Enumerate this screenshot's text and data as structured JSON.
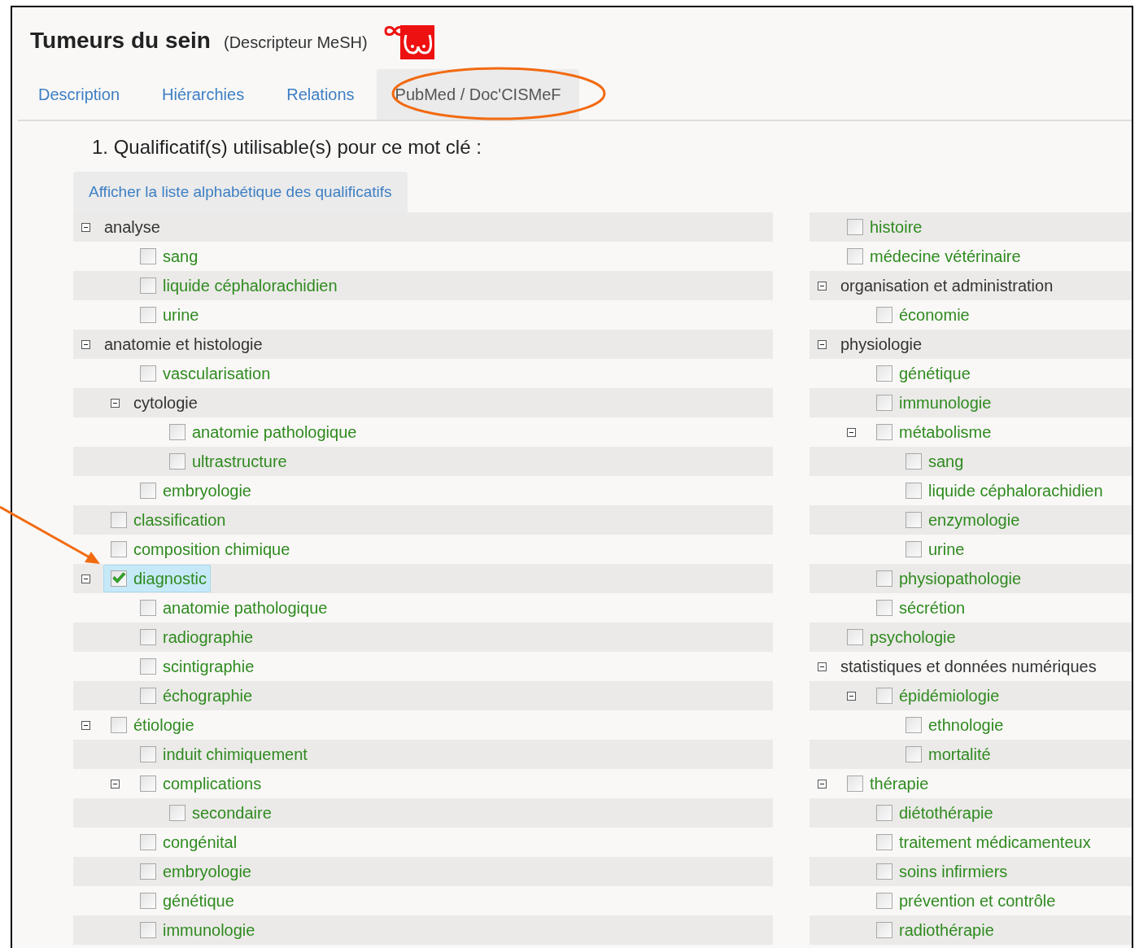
{
  "header": {
    "title": "Tumeurs du sein",
    "subtitle": "(Descripteur MeSH)"
  },
  "tabs": [
    {
      "label": "Description",
      "selected": false
    },
    {
      "label": "Hiérarchies",
      "selected": false
    },
    {
      "label": "Relations",
      "selected": false
    },
    {
      "label": "PubMed / Doc'CISMeF",
      "selected": true
    }
  ],
  "section_heading": "1. Qualificatif(s) utilisable(s) pour ce mot clé :",
  "alphabetical_button": "Afficher la liste alphabétique des qualificatifs",
  "columns": [
    {
      "items": [
        {
          "kind": "group",
          "label": "analyse",
          "expanded": true,
          "children": [
            {
              "kind": "qualifier",
              "label": "sang",
              "checked": false,
              "selected": false
            },
            {
              "kind": "qualifier",
              "label": "liquide céphalorachidien",
              "checked": false,
              "selected": false
            },
            {
              "kind": "qualifier",
              "label": "urine",
              "checked": false,
              "selected": false
            }
          ]
        },
        {
          "kind": "group",
          "label": "anatomie et histologie",
          "expanded": true,
          "children": [
            {
              "kind": "qualifier",
              "label": "vascularisation",
              "checked": false,
              "selected": false
            },
            {
              "kind": "group",
              "label": "cytologie",
              "expanded": true,
              "children": [
                {
                  "kind": "qualifier",
                  "label": "anatomie pathologique",
                  "checked": false,
                  "selected": false
                },
                {
                  "kind": "qualifier",
                  "label": "ultrastructure",
                  "checked": false,
                  "selected": false
                }
              ]
            },
            {
              "kind": "qualifier",
              "label": "embryologie",
              "checked": false,
              "selected": false
            }
          ]
        },
        {
          "kind": "qualifier",
          "label": "classification",
          "checked": false,
          "selected": false
        },
        {
          "kind": "qualifier",
          "label": "composition chimique",
          "checked": false,
          "selected": false
        },
        {
          "kind": "qualifier",
          "label": "diagnostic",
          "checked": true,
          "selected": true,
          "expanded": true,
          "children": [
            {
              "kind": "qualifier",
              "label": "anatomie pathologique",
              "checked": false,
              "selected": false
            },
            {
              "kind": "qualifier",
              "label": "radiographie",
              "checked": false,
              "selected": false
            },
            {
              "kind": "qualifier",
              "label": "scintigraphie",
              "checked": false,
              "selected": false
            },
            {
              "kind": "qualifier",
              "label": "échographie",
              "checked": false,
              "selected": false
            }
          ]
        },
        {
          "kind": "qualifier",
          "label": "étiologie",
          "checked": false,
          "selected": false,
          "expanded": true,
          "children": [
            {
              "kind": "qualifier",
              "label": "induit chimiquement",
              "checked": false,
              "selected": false
            },
            {
              "kind": "qualifier",
              "label": "complications",
              "checked": false,
              "selected": false,
              "expanded": true,
              "children": [
                {
                  "kind": "qualifier",
                  "label": "secondaire",
                  "checked": false,
                  "selected": false
                }
              ]
            },
            {
              "kind": "qualifier",
              "label": "congénital",
              "checked": false,
              "selected": false
            },
            {
              "kind": "qualifier",
              "label": "embryologie",
              "checked": false,
              "selected": false
            },
            {
              "kind": "qualifier",
              "label": "génétique",
              "checked": false,
              "selected": false
            },
            {
              "kind": "qualifier",
              "label": "immunologie",
              "checked": false,
              "selected": false
            }
          ]
        }
      ]
    },
    {
      "items": [
        {
          "kind": "qualifier",
          "label": "histoire",
          "checked": false,
          "selected": false
        },
        {
          "kind": "qualifier",
          "label": "médecine vétérinaire",
          "checked": false,
          "selected": false
        },
        {
          "kind": "group",
          "label": "organisation et administration",
          "expanded": true,
          "children": [
            {
              "kind": "qualifier",
              "label": "économie",
              "checked": false,
              "selected": false
            }
          ]
        },
        {
          "kind": "group",
          "label": "physiologie",
          "expanded": true,
          "children": [
            {
              "kind": "qualifier",
              "label": "génétique",
              "checked": false,
              "selected": false
            },
            {
              "kind": "qualifier",
              "label": "immunologie",
              "checked": false,
              "selected": false
            },
            {
              "kind": "qualifier",
              "label": "métabolisme",
              "checked": false,
              "selected": false,
              "expanded": true,
              "children": [
                {
                  "kind": "qualifier",
                  "label": "sang",
                  "checked": false,
                  "selected": false
                },
                {
                  "kind": "qualifier",
                  "label": "liquide céphalorachidien",
                  "checked": false,
                  "selected": false
                },
                {
                  "kind": "qualifier",
                  "label": "enzymologie",
                  "checked": false,
                  "selected": false
                },
                {
                  "kind": "qualifier",
                  "label": "urine",
                  "checked": false,
                  "selected": false
                }
              ]
            },
            {
              "kind": "qualifier",
              "label": "physiopathologie",
              "checked": false,
              "selected": false
            },
            {
              "kind": "qualifier",
              "label": "sécrétion",
              "checked": false,
              "selected": false
            }
          ]
        },
        {
          "kind": "qualifier",
          "label": "psychologie",
          "checked": false,
          "selected": false
        },
        {
          "kind": "group",
          "label": "statistiques et données numériques",
          "expanded": true,
          "children": [
            {
              "kind": "qualifier",
              "label": "épidémiologie",
              "checked": false,
              "selected": false,
              "expanded": true,
              "children": [
                {
                  "kind": "qualifier",
                  "label": "ethnologie",
                  "checked": false,
                  "selected": false
                },
                {
                  "kind": "qualifier",
                  "label": "mortalité",
                  "checked": false,
                  "selected": false
                }
              ]
            }
          ]
        },
        {
          "kind": "qualifier",
          "label": "thérapie",
          "checked": false,
          "selected": false,
          "expanded": true,
          "children": [
            {
              "kind": "qualifier",
              "label": "diétothérapie",
              "checked": false,
              "selected": false
            },
            {
              "kind": "qualifier",
              "label": "traitement médicamenteux",
              "checked": false,
              "selected": false
            },
            {
              "kind": "qualifier",
              "label": "soins infirmiers",
              "checked": false,
              "selected": false
            },
            {
              "kind": "qualifier",
              "label": "prévention et contrôle",
              "checked": false,
              "selected": false
            },
            {
              "kind": "qualifier",
              "label": "radiothérapie",
              "checked": false,
              "selected": false
            }
          ]
        }
      ]
    }
  ]
}
